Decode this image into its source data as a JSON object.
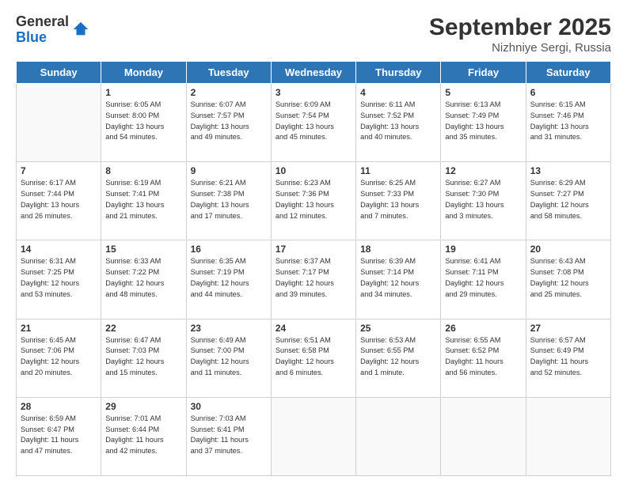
{
  "logo": {
    "general": "General",
    "blue": "Blue"
  },
  "title": "September 2025",
  "subtitle": "Nizhniye Sergi, Russia",
  "days_of_week": [
    "Sunday",
    "Monday",
    "Tuesday",
    "Wednesday",
    "Thursday",
    "Friday",
    "Saturday"
  ],
  "weeks": [
    [
      {
        "day": "",
        "info": ""
      },
      {
        "day": "1",
        "info": "Sunrise: 6:05 AM\nSunset: 8:00 PM\nDaylight: 13 hours\nand 54 minutes."
      },
      {
        "day": "2",
        "info": "Sunrise: 6:07 AM\nSunset: 7:57 PM\nDaylight: 13 hours\nand 49 minutes."
      },
      {
        "day": "3",
        "info": "Sunrise: 6:09 AM\nSunset: 7:54 PM\nDaylight: 13 hours\nand 45 minutes."
      },
      {
        "day": "4",
        "info": "Sunrise: 6:11 AM\nSunset: 7:52 PM\nDaylight: 13 hours\nand 40 minutes."
      },
      {
        "day": "5",
        "info": "Sunrise: 6:13 AM\nSunset: 7:49 PM\nDaylight: 13 hours\nand 35 minutes."
      },
      {
        "day": "6",
        "info": "Sunrise: 6:15 AM\nSunset: 7:46 PM\nDaylight: 13 hours\nand 31 minutes."
      }
    ],
    [
      {
        "day": "7",
        "info": "Sunrise: 6:17 AM\nSunset: 7:44 PM\nDaylight: 13 hours\nand 26 minutes."
      },
      {
        "day": "8",
        "info": "Sunrise: 6:19 AM\nSunset: 7:41 PM\nDaylight: 13 hours\nand 21 minutes."
      },
      {
        "day": "9",
        "info": "Sunrise: 6:21 AM\nSunset: 7:38 PM\nDaylight: 13 hours\nand 17 minutes."
      },
      {
        "day": "10",
        "info": "Sunrise: 6:23 AM\nSunset: 7:36 PM\nDaylight: 13 hours\nand 12 minutes."
      },
      {
        "day": "11",
        "info": "Sunrise: 6:25 AM\nSunset: 7:33 PM\nDaylight: 13 hours\nand 7 minutes."
      },
      {
        "day": "12",
        "info": "Sunrise: 6:27 AM\nSunset: 7:30 PM\nDaylight: 13 hours\nand 3 minutes."
      },
      {
        "day": "13",
        "info": "Sunrise: 6:29 AM\nSunset: 7:27 PM\nDaylight: 12 hours\nand 58 minutes."
      }
    ],
    [
      {
        "day": "14",
        "info": "Sunrise: 6:31 AM\nSunset: 7:25 PM\nDaylight: 12 hours\nand 53 minutes."
      },
      {
        "day": "15",
        "info": "Sunrise: 6:33 AM\nSunset: 7:22 PM\nDaylight: 12 hours\nand 48 minutes."
      },
      {
        "day": "16",
        "info": "Sunrise: 6:35 AM\nSunset: 7:19 PM\nDaylight: 12 hours\nand 44 minutes."
      },
      {
        "day": "17",
        "info": "Sunrise: 6:37 AM\nSunset: 7:17 PM\nDaylight: 12 hours\nand 39 minutes."
      },
      {
        "day": "18",
        "info": "Sunrise: 6:39 AM\nSunset: 7:14 PM\nDaylight: 12 hours\nand 34 minutes."
      },
      {
        "day": "19",
        "info": "Sunrise: 6:41 AM\nSunset: 7:11 PM\nDaylight: 12 hours\nand 29 minutes."
      },
      {
        "day": "20",
        "info": "Sunrise: 6:43 AM\nSunset: 7:08 PM\nDaylight: 12 hours\nand 25 minutes."
      }
    ],
    [
      {
        "day": "21",
        "info": "Sunrise: 6:45 AM\nSunset: 7:06 PM\nDaylight: 12 hours\nand 20 minutes."
      },
      {
        "day": "22",
        "info": "Sunrise: 6:47 AM\nSunset: 7:03 PM\nDaylight: 12 hours\nand 15 minutes."
      },
      {
        "day": "23",
        "info": "Sunrise: 6:49 AM\nSunset: 7:00 PM\nDaylight: 12 hours\nand 11 minutes."
      },
      {
        "day": "24",
        "info": "Sunrise: 6:51 AM\nSunset: 6:58 PM\nDaylight: 12 hours\nand 6 minutes."
      },
      {
        "day": "25",
        "info": "Sunrise: 6:53 AM\nSunset: 6:55 PM\nDaylight: 12 hours\nand 1 minute."
      },
      {
        "day": "26",
        "info": "Sunrise: 6:55 AM\nSunset: 6:52 PM\nDaylight: 11 hours\nand 56 minutes."
      },
      {
        "day": "27",
        "info": "Sunrise: 6:57 AM\nSunset: 6:49 PM\nDaylight: 11 hours\nand 52 minutes."
      }
    ],
    [
      {
        "day": "28",
        "info": "Sunrise: 6:59 AM\nSunset: 6:47 PM\nDaylight: 11 hours\nand 47 minutes."
      },
      {
        "day": "29",
        "info": "Sunrise: 7:01 AM\nSunset: 6:44 PM\nDaylight: 11 hours\nand 42 minutes."
      },
      {
        "day": "30",
        "info": "Sunrise: 7:03 AM\nSunset: 6:41 PM\nDaylight: 11 hours\nand 37 minutes."
      },
      {
        "day": "",
        "info": ""
      },
      {
        "day": "",
        "info": ""
      },
      {
        "day": "",
        "info": ""
      },
      {
        "day": "",
        "info": ""
      }
    ]
  ]
}
